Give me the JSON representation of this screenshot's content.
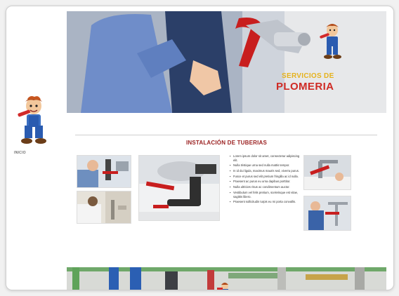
{
  "sidebar": {
    "nav_label": "INICIO"
  },
  "hero": {
    "line1": "SERVICIOS DE",
    "line2": "PLOMERIA"
  },
  "section": {
    "title": "INSTALACIÓN DE TUBERIAS",
    "bullets": [
      "Lorem ipsum dolor sit amet, consectetur adipiscing elit.",
      "Nulla tristique urna sed nulla mattis tempor.",
      "In id dui ligula, maximus mauris sed, viverra purus.",
      "Fusce et purus sed elit pretium fringilla ac id nulla.",
      "Praesent ac purus eu urna dapibus porttitor.",
      "Nulla ultricies risus ac condimentum auctor.",
      "Vestibulum vel felis pretium, scelerisque est vitae, sagittis libero.",
      "Praesent sollicitudin turpis eu mi porta convallis."
    ]
  },
  "colors": {
    "title_red": "#9a1f1f",
    "hero_yellow": "#e6b21c",
    "hero_red": "#cf2a24"
  },
  "icons": {
    "mascot": "plumber-mascot-icon"
  }
}
